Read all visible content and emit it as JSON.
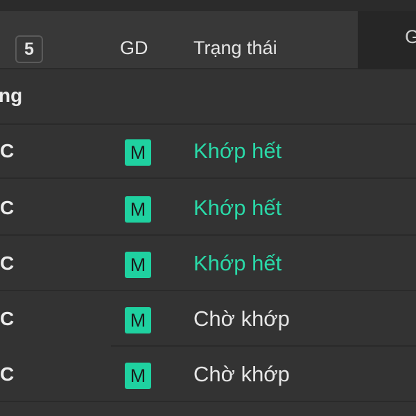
{
  "header": {
    "count": "5",
    "col_gd": "GD",
    "col_status": "Trạng thái",
    "col_cut": "G"
  },
  "group": {
    "label": "ng"
  },
  "rows": [
    {
      "symbol": "C",
      "type": "M",
      "status": "Khớp hết"
    },
    {
      "symbol": "C",
      "type": "M",
      "status": "Khớp hết"
    },
    {
      "symbol": "C",
      "type": "M",
      "status": "Khớp hết"
    },
    {
      "symbol": "C",
      "type": "M",
      "status": "Chờ khớp"
    },
    {
      "symbol": "C",
      "type": "M",
      "status": "Chờ khớp"
    }
  ],
  "colors": {
    "background": "#333333",
    "badge": "#1fd1a0",
    "filled_status": "#2ad9a8",
    "pending_status": "#e6e6e6"
  }
}
